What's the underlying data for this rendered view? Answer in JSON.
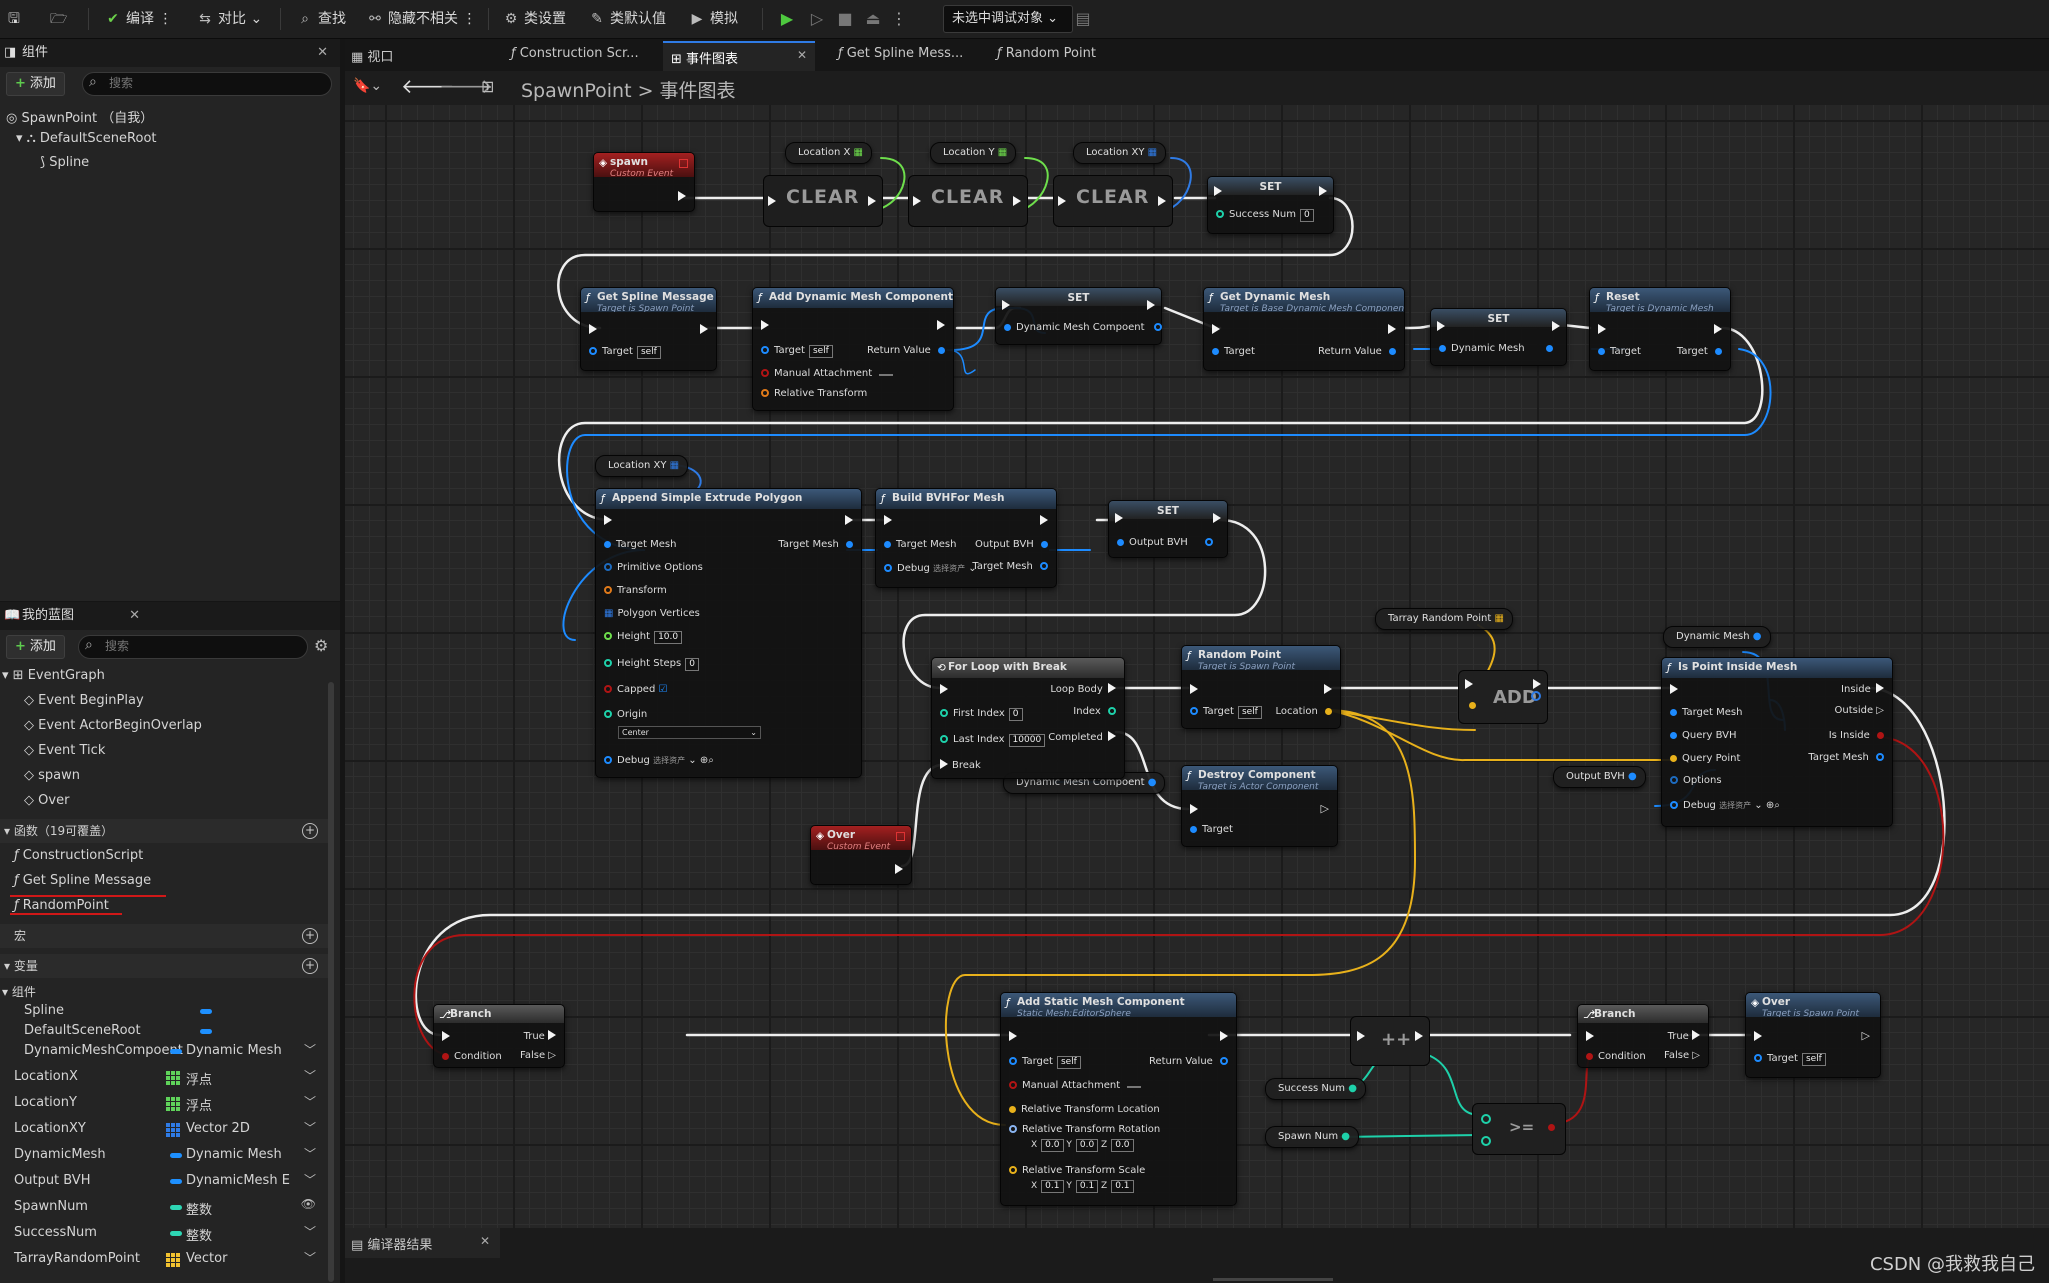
{
  "toolbar": {
    "compile": "编译",
    "diff": "对比",
    "find": "查找",
    "hide_unrelated": "隐藏不相关",
    "class_settings": "类设置",
    "class_defaults": "类默认值",
    "simulate": "模拟",
    "debug_target": "未选中调试对象"
  },
  "doc_tabs": {
    "viewport": "视口",
    "construction": "Construction Scr...",
    "event_graph": "事件图表",
    "get_spline": "Get Spline Mess...",
    "random_point": "Random Point"
  },
  "breadcrumb": {
    "root": "SpawnPoint",
    "sep": ">",
    "current": "事件图表"
  },
  "components_panel": {
    "title": "组件",
    "add": "添加",
    "search_placeholder": "搜索",
    "items": [
      "SpawnPoint （自我）",
      "DefaultSceneRoot",
      "Spline"
    ]
  },
  "myblueprint_panel": {
    "title": "我的蓝图",
    "add": "添加",
    "search_placeholder": "搜索",
    "graphs_header": "EventGraph",
    "events": [
      "Event BeginPlay",
      "Event ActorBeginOverlap",
      "Event Tick",
      "spawn",
      "Over"
    ],
    "functions_header": "函数（19可覆盖）",
    "functions": [
      "ConstructionScript",
      "Get Spline Message",
      "RandomPoint"
    ],
    "macros_header": "宏",
    "variables_header": "变量",
    "components_subheader": "组件",
    "variables": [
      {
        "name": "Spline",
        "type": "",
        "color": "#1e90ff",
        "kind": "pill"
      },
      {
        "name": "DefaultSceneRoot",
        "type": "",
        "color": "#1e90ff",
        "kind": "pill"
      },
      {
        "name": "DynamicMeshCompoent",
        "type": "Dynamic Mesh",
        "color": "#1e90ff",
        "kind": "pill"
      },
      {
        "name": "LocationX",
        "type": "浮点",
        "color": "#5fd35a",
        "kind": "grid"
      },
      {
        "name": "LocationY",
        "type": "浮点",
        "color": "#5fd35a",
        "kind": "grid"
      },
      {
        "name": "LocationXY",
        "type": "Vector 2D",
        "color": "#2f7be5",
        "kind": "grid"
      },
      {
        "name": "DynamicMesh",
        "type": "Dynamic Mesh",
        "color": "#1e90ff",
        "kind": "pill"
      },
      {
        "name": "Output BVH",
        "type": "DynamicMesh E",
        "color": "#1e90ff",
        "kind": "pill"
      },
      {
        "name": "SpawnNum",
        "type": "整数",
        "color": "#2ed6b4",
        "kind": "pill"
      },
      {
        "name": "SuccessNum",
        "type": "整数",
        "color": "#2ed6b4",
        "kind": "pill"
      },
      {
        "name": "TarrayRandomPoint",
        "type": "Vector",
        "color": "#f2c230",
        "kind": "grid"
      }
    ]
  },
  "compiler_tab": "编译器结果",
  "watermark": "CSDN @我救我自己",
  "graph": {
    "getters": {
      "locx": "Location X",
      "locy": "Location Y",
      "locxy": "Location XY",
      "locxy2": "Location XY",
      "tarray": "Tarray Random Point",
      "dynmesh": "Dynamic Mesh",
      "outbvh": "Output BVH",
      "dmc": "Dynamic Mesh Compoent",
      "success": "Success Num",
      "spawnnum": "Spawn Num"
    },
    "clear": "CLEAR",
    "spawn": {
      "title": "spawn",
      "sub": "Custom Event"
    },
    "over_event": {
      "title": "Over",
      "sub": "Custom Event"
    },
    "set_success": {
      "title": "SET",
      "pin": "Success Num",
      "val": "0"
    },
    "get_spline": {
      "title": "Get Spline Message",
      "sub": "Target is Spawn Point",
      "target": "Target",
      "self": "self"
    },
    "add_dyn": {
      "title": "Add Dynamic Mesh Component",
      "target": "Target",
      "self": "self",
      "ret": "Return Value",
      "manual": "Manual Attachment",
      "rel": "Relative Transform"
    },
    "set_dmc": {
      "title": "SET",
      "pin": "Dynamic Mesh Compoent"
    },
    "get_dyn": {
      "title": "Get Dynamic Mesh",
      "sub": "Target is Base Dynamic Mesh Component",
      "target": "Target",
      "ret": "Return Value"
    },
    "set_dm": {
      "title": "SET",
      "pin": "Dynamic Mesh"
    },
    "reset": {
      "title": "Reset",
      "sub": "Target is Dynamic Mesh",
      "target": "Target",
      "out": "Target"
    },
    "append": {
      "title": "Append Simple Extrude Polygon",
      "target": "Target Mesh",
      "out": "Target Mesh",
      "prim": "Primitive Options",
      "transform": "Transform",
      "poly": "Polygon Vertices",
      "height": "Height",
      "height_val": "10.0",
      "steps": "Height Steps",
      "steps_val": "0",
      "capped": "Capped",
      "origin": "Origin",
      "origin_val": "Center",
      "debug": "Debug",
      "debug_val": "选择资产"
    },
    "bvh": {
      "title": "Build BVHFor Mesh",
      "target": "Target Mesh",
      "outbvh": "Output BVH",
      "debug": "Debug",
      "debug_val": "选择资产",
      "tmesh": "Target Mesh"
    },
    "set_bvh": {
      "title": "SET",
      "pin": "Output BVH"
    },
    "forloop": {
      "title": "For Loop with Break",
      "body": "Loop Body",
      "first": "First Index",
      "first_val": "0",
      "index": "Index",
      "last": "Last Index",
      "last_val": "10000",
      "completed": "Completed",
      "brk": "Break"
    },
    "random": {
      "title": "Random Point",
      "sub": "Target is Spawn Point",
      "target": "Target",
      "self": "self",
      "loc": "Location"
    },
    "destroy": {
      "title": "Destroy Component",
      "sub": "Target is Actor Component",
      "target": "Target"
    },
    "add": "ADD",
    "inside": {
      "title": "Is Point Inside Mesh",
      "target": "Target Mesh",
      "inside": "Inside",
      "bvh": "Query BVH",
      "outside": "Outside",
      "qp": "Query Point",
      "isin": "Is Inside",
      "opts": "Options",
      "tmesh": "Target Mesh",
      "debug": "Debug",
      "debug_val": "选择资产"
    },
    "branch1": {
      "title": "Branch",
      "cond": "Condition",
      "t": "True",
      "f": "False"
    },
    "addstatic": {
      "title": "Add Static Mesh Component",
      "sub": "Static Mesh:EditorSphere",
      "target": "Target",
      "self": "self",
      "ret": "Return Value",
      "manual": "Manual Attachment",
      "loc": "Relative Transform Location",
      "rot": "Relative Transform Rotation",
      "scale": "Relative Transform Scale",
      "rx": "0.0",
      "ry": "0.0",
      "rz": "0.0",
      "sx": "0.1",
      "sy": "0.1",
      "sz": "0.1"
    },
    "inc": "++",
    "gte": ">=",
    "branch2": {
      "title": "Branch",
      "cond": "Condition",
      "t": "True",
      "f": "False"
    },
    "over_call": {
      "title": "Over",
      "sub": "Target is Spawn Point",
      "target": "Target",
      "self": "self"
    }
  }
}
